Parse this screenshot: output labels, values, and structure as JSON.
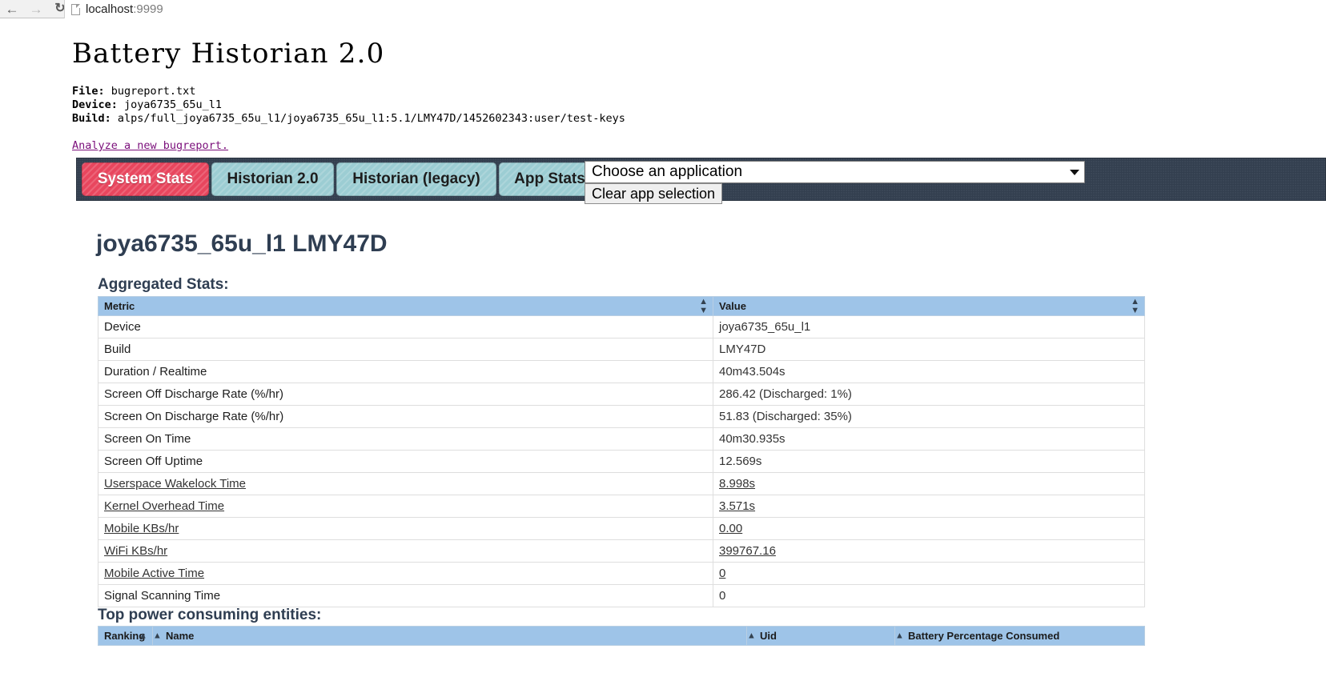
{
  "browser": {
    "back_icon": "back-arrow-icon",
    "forward_icon": "forward-arrow-icon",
    "reload_icon": "reload-icon",
    "url_host": "localhost",
    "url_port": ":9999"
  },
  "page": {
    "title": "Battery Historian 2.0",
    "meta": [
      {
        "key": "File:",
        "value": "bugreport.txt"
      },
      {
        "key": "Device:",
        "value": "joya6735_65u_l1"
      },
      {
        "key": "Build:",
        "value": "alps/full_joya6735_65u_l1/joya6735_65u_l1:5.1/LMY47D/1452602343:user/test-keys"
      }
    ],
    "analyze_link": "Analyze a new bugreport."
  },
  "tabs": [
    {
      "label": "System Stats",
      "active": true
    },
    {
      "label": "Historian 2.0",
      "active": false
    },
    {
      "label": "Historian (legacy)",
      "active": false
    },
    {
      "label": "App Stats",
      "active": false
    }
  ],
  "app_selector": {
    "selected": "Choose an application",
    "arrow_icon": "chevron-down-icon",
    "clear_label": "Clear app selection"
  },
  "main": {
    "device_heading": "joya6735_65u_l1 LMY47D",
    "aggregated_heading": "Aggregated Stats:",
    "top_entities_heading": "Top power consuming entities:"
  },
  "aggregated_table": {
    "columns": [
      "Metric",
      "Value"
    ],
    "rows": [
      {
        "metric": "Device",
        "value": "joya6735_65u_l1",
        "metric_link": false,
        "value_link": false
      },
      {
        "metric": "Build",
        "value": "LMY47D",
        "metric_link": false,
        "value_link": false
      },
      {
        "metric": "Duration / Realtime",
        "value": "40m43.504s",
        "metric_link": false,
        "value_link": false
      },
      {
        "metric": "Screen Off Discharge Rate (%/hr)",
        "value": "286.42 (Discharged: 1%)",
        "metric_link": false,
        "value_link": false
      },
      {
        "metric": "Screen On Discharge Rate (%/hr)",
        "value": "51.83 (Discharged: 35%)",
        "metric_link": false,
        "value_link": false
      },
      {
        "metric": "Screen On Time",
        "value": "40m30.935s",
        "metric_link": false,
        "value_link": false
      },
      {
        "metric": "Screen Off Uptime",
        "value": "12.569s",
        "metric_link": false,
        "value_link": false
      },
      {
        "metric": "Userspace Wakelock Time",
        "value": "8.998s",
        "metric_link": true,
        "value_link": true
      },
      {
        "metric": "Kernel Overhead Time",
        "value": "3.571s",
        "metric_link": true,
        "value_link": true
      },
      {
        "metric": "Mobile KBs/hr",
        "value": "0.00",
        "metric_link": true,
        "value_link": true
      },
      {
        "metric": "WiFi KBs/hr",
        "value": "399767.16",
        "metric_link": true,
        "value_link": true
      },
      {
        "metric": "Mobile Active Time",
        "value": "0",
        "metric_link": true,
        "value_link": true
      },
      {
        "metric": "Signal Scanning Time",
        "value": "0",
        "metric_link": false,
        "value_link": false
      }
    ]
  },
  "top_entities_table": {
    "columns": [
      "Ranking",
      "Name",
      "Uid",
      "Battery Percentage Consumed"
    ],
    "sorted_column": "Ranking",
    "sort_direction": "asc",
    "rows": []
  }
}
